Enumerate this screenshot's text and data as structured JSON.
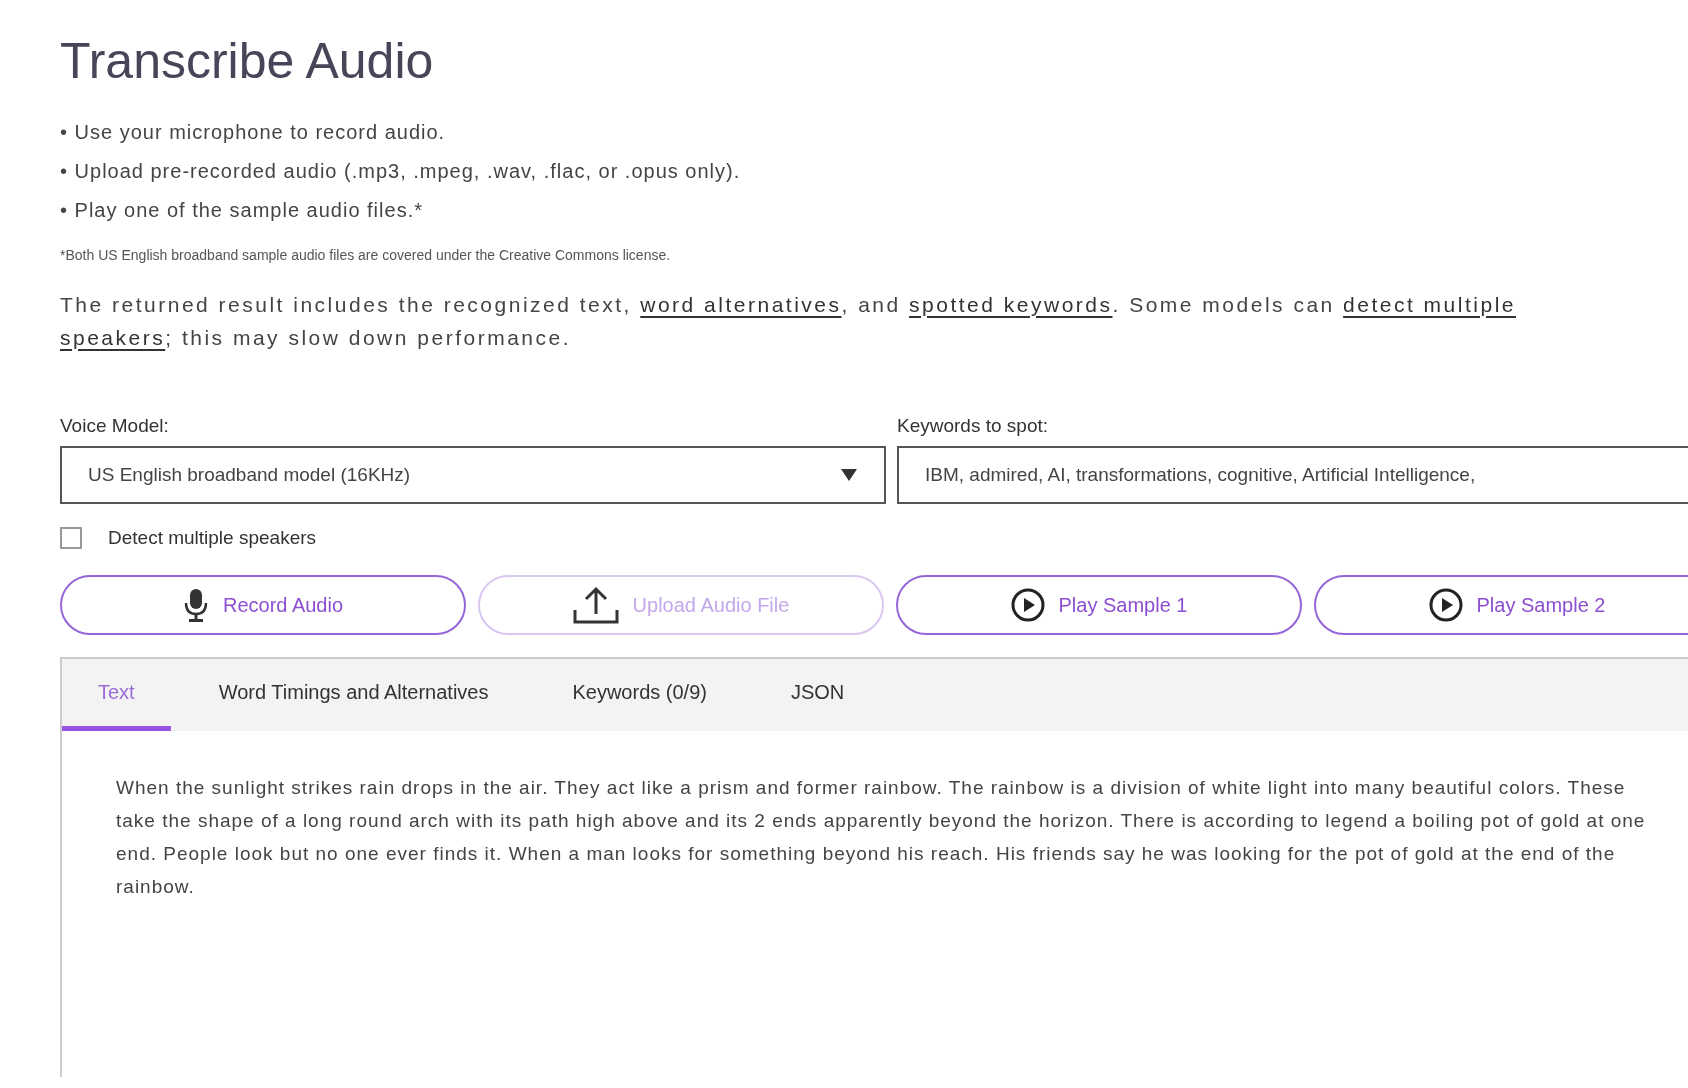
{
  "title": "Transcribe Audio",
  "instructions": [
    "• Use your microphone to record audio.",
    "• Upload pre-recorded audio (.mp3, .mpeg, .wav, .flac, or .opus only).",
    "• Play one of the sample audio files.*"
  ],
  "footnote": "*Both US English broadband sample audio files are covered under the Creative Commons license.",
  "intro": [
    {
      "kind": "text",
      "text": "The returned result includes the recognized text, "
    },
    {
      "kind": "link",
      "text": "word alternatives"
    },
    {
      "kind": "text",
      "text": ", and "
    },
    {
      "kind": "link",
      "text": "spotted keywords"
    },
    {
      "kind": "text",
      "text": ". Some models can "
    },
    {
      "kind": "link",
      "text": "detect multiple"
    },
    {
      "kind": "break"
    },
    {
      "kind": "link",
      "text": "speakers"
    },
    {
      "kind": "text",
      "text": "; this may slow down performance."
    }
  ],
  "voice_model": {
    "label": "Voice Model:",
    "value": "US English broadband model (16KHz)"
  },
  "keywords": {
    "label": "Keywords to spot:",
    "value": "IBM, admired, AI, transformations, cognitive, Artificial Intelligence,"
  },
  "detect_speakers": {
    "label": "Detect multiple speakers",
    "checked": false
  },
  "buttons": [
    {
      "kind": "mic",
      "label": "Record Audio",
      "disabled": false
    },
    {
      "kind": "upload",
      "label": "Upload Audio File",
      "disabled": true
    },
    {
      "kind": "play",
      "label": "Play Sample 1",
      "disabled": false
    },
    {
      "kind": "play",
      "label": "Play Sample 2",
      "disabled": false
    }
  ],
  "tabs": [
    {
      "label": "Text",
      "selected": true
    },
    {
      "label": "Word Timings and Alternatives",
      "selected": false
    },
    {
      "label": "Keywords (0/9)",
      "selected": false
    },
    {
      "label": "JSON",
      "selected": false
    }
  ],
  "transcript": "When the sunlight strikes rain drops in the air. They act like a prism and former rainbow. The rainbow is a division of white light into many beautiful colors. These take the shape of a long round arch with its path high above and its 2 ends apparently beyond the horizon. There is according to legend a boiling pot of gold at one end. People look but no one ever finds it. When a man looks for something beyond his reach. His friends say he was looking for the pot of gold at the end of the rainbow."
}
